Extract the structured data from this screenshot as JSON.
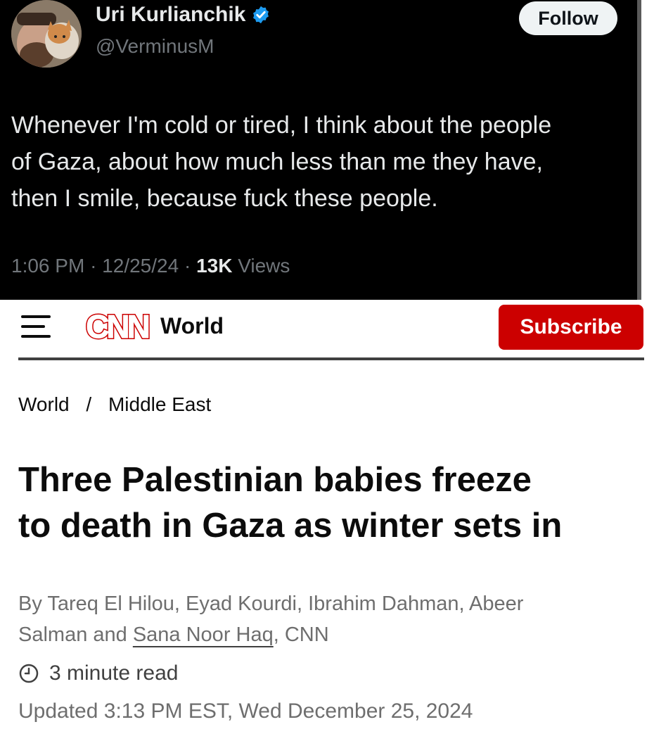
{
  "tweet": {
    "display_name": "Uri Kurlianchik",
    "handle": "@VerminusM",
    "follow_label": "Follow",
    "text_lines": [
      "Whenever I'm cold or tired, I think about the people",
      "of Gaza, about how much less than me they have,",
      "then I smile, because fuck these people."
    ],
    "time": "1:06 PM",
    "date": "12/25/24",
    "views_count": "13K",
    "views_label": "Views",
    "meta_separator": "·",
    "verified_icon": "verified-badge-icon",
    "accent_color": "#1d9bf0"
  },
  "header": {
    "menu_icon": "hamburger-menu-icon",
    "logo_text": "CNN",
    "section": "World",
    "subscribe_label": "Subscribe",
    "brand_color": "#cc0000"
  },
  "article": {
    "breadcrumb": [
      "World",
      "Middle East"
    ],
    "breadcrumb_separator": "/",
    "headline_lines": [
      "Three Palestinian babies freeze",
      "to death in Gaza as winter sets in"
    ],
    "byline_line1": "By Tareq El Hilou, Eyad Kourdi, Ibrahim Dahman, Abeer",
    "byline_line2_prefix": "Salman and ",
    "byline_link": "Sana Noor Haq",
    "byline_line2_suffix": ", CNN",
    "read_time": "3 minute read",
    "read_time_icon": "clock-icon",
    "updated": "Updated 3:13 PM EST, Wed December 25, 2024"
  }
}
